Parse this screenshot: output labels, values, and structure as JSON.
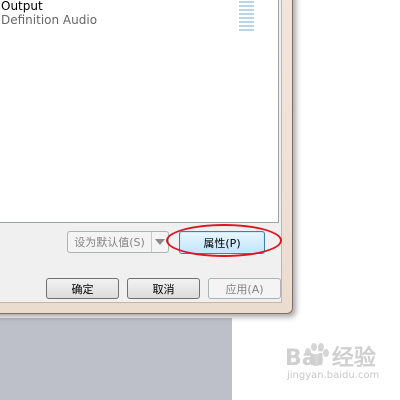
{
  "device_list": {
    "device_name": "Output",
    "device_subtitle": "Definition Audio"
  },
  "buttons": {
    "set_default": "设为默认值(S)",
    "properties": "属性(P)",
    "ok": "确定",
    "cancel": "取消",
    "apply": "应用(A)"
  },
  "watermark": {
    "text": "Bai 经验",
    "url": "jingyan.baidu.com"
  },
  "colors": {
    "annotation_red": "#e0151e",
    "selected_button_blue": "#bee6fd"
  }
}
